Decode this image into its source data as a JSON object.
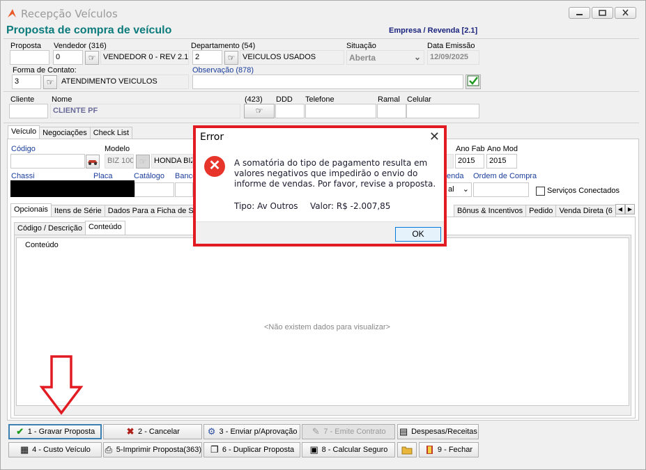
{
  "window": {
    "title": "Recepção Veículos",
    "heading": "Proposta de compra de veículo",
    "empresa": "Empresa / Revenda [2.1]"
  },
  "header_form": {
    "proposta_label": "Proposta",
    "proposta_value": "",
    "vendedor_label": "Vendedor (316)",
    "vendedor_code": "0",
    "vendedor_name": "VENDEDOR 0 - REV 2.1",
    "departamento_label": "Departamento (54)",
    "departamento_code": "2",
    "departamento_name": "VEICULOS USADOS",
    "situacao_label": "Situação",
    "situacao_value": "Aberta",
    "data_emissao_label": "Data Emissão",
    "data_emissao_value": "12/09/2025",
    "forma_contato_label": "Forma de Contato:",
    "forma_contato_code": "3",
    "forma_contato_name": "ATENDIMENTO VEICULOS",
    "observacao_label": "Observação (878)",
    "observacao_value": ""
  },
  "cliente": {
    "cliente_label": "Cliente",
    "nome_label": "Nome",
    "nome_value": "CLIENTE PF",
    "count_label": "(423)",
    "ddd_label": "DDD",
    "telefone_label": "Telefone",
    "ramal_label": "Ramal",
    "celular_label": "Celular"
  },
  "main_tabs": [
    "Veículo",
    "Negociações",
    "Check List"
  ],
  "veiculo": {
    "codigo_label": "Código",
    "modelo_label": "Modelo",
    "modelo_code": "BIZ 100",
    "modelo_name": "HONDA BIZ",
    "ano_fab_label": "Ano Fab",
    "ano_fab_value": "2015",
    "ano_mod_label": "Ano Mod",
    "ano_mod_value": "2015",
    "chassi_label": "Chassi",
    "placa_label": "Placa",
    "catalogo_label": "Catálogo",
    "banco_label": "Banco",
    "venda_label": "enda",
    "venda_value": "al",
    "ordem_compra_label": "Ordem de Compra",
    "servicos_label": "Serviços Conectados"
  },
  "sub_tabs_left": [
    "Opcionais",
    "Itens de Série",
    "Dados Para a Ficha de Se"
  ],
  "sub_tabs_right": [
    "Bônus & Incentivos",
    "Pedido",
    "Venda Direta (6"
  ],
  "inner_tabs": [
    "Código / Descrição",
    "Conteúdo"
  ],
  "grid": {
    "column": "Conteúdo",
    "empty_message": "<Não existem dados para visualizar>"
  },
  "buttons_row1": [
    {
      "label": "1 - Gravar Proposta",
      "icon": "check-icon"
    },
    {
      "label": "2 - Cancelar",
      "icon": "x-icon"
    },
    {
      "label": "3 - Enviar p/Aprovação",
      "icon": "send-icon"
    },
    {
      "label": "7 - Emite Contrato",
      "icon": "contract-icon"
    },
    {
      "label": "Despesas/Receitas",
      "icon": "expenses-icon"
    }
  ],
  "buttons_row2": [
    {
      "label": "4 - Custo Veículo",
      "icon": "calculator-icon"
    },
    {
      "label": "5-Imprimir Proposta(363)",
      "icon": "print-icon"
    },
    {
      "label": "6 - Duplicar Proposta",
      "icon": "duplicate-icon"
    },
    {
      "label": "8 - Calcular Seguro",
      "icon": "document-icon"
    },
    {
      "label": "",
      "icon": "folder-icon"
    },
    {
      "label": "9 - Fechar",
      "icon": "exit-icon"
    }
  ],
  "dialog": {
    "title": "Error",
    "message": "A somatória do tipo de pagamento resulta em valores negativos que impedirão o envio do informe de vendas. Por favor, revise a proposta.",
    "tipo": "Tipo: Av Outros",
    "valor": "Valor: R$ -2.007,85",
    "ok_label": "OK"
  },
  "colors": {
    "heading": "#0b7b7b",
    "dialog_border": "#e21b23",
    "error_icon": "#e8352c",
    "annotation_arrow": "#e21b23"
  }
}
